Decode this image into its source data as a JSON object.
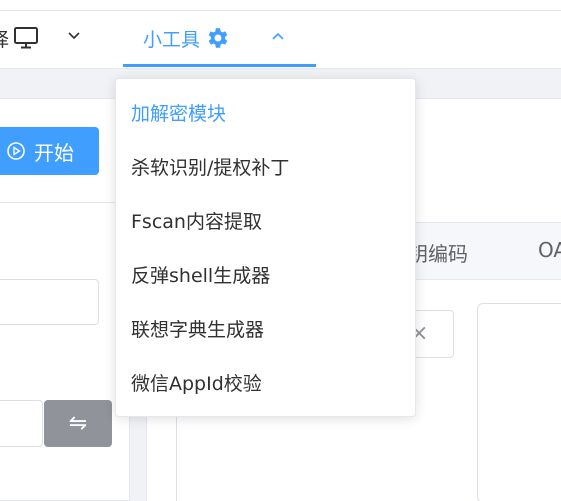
{
  "header": {
    "select_label": "择",
    "tools_label": "小工具"
  },
  "start_button": {
    "label": "开始"
  },
  "swap_button": {
    "label": "⇋"
  },
  "tabs": [
    {
      "label": "钥编码"
    },
    {
      "label": "OA"
    }
  ],
  "clear_icon": "×",
  "dropdown": {
    "items": [
      {
        "label": "加解密模块",
        "active": true
      },
      {
        "label": "杀软识别/提权补丁",
        "active": false
      },
      {
        "label": "Fscan内容提取",
        "active": false
      },
      {
        "label": "反弹shell生成器",
        "active": false
      },
      {
        "label": "联想字典生成器",
        "active": false
      },
      {
        "label": "微信AppId校验",
        "active": false
      }
    ]
  },
  "colors": {
    "accent": "#409eff",
    "text": "#303133",
    "border": "#e4e7ed",
    "swap_bg": "#909399"
  }
}
